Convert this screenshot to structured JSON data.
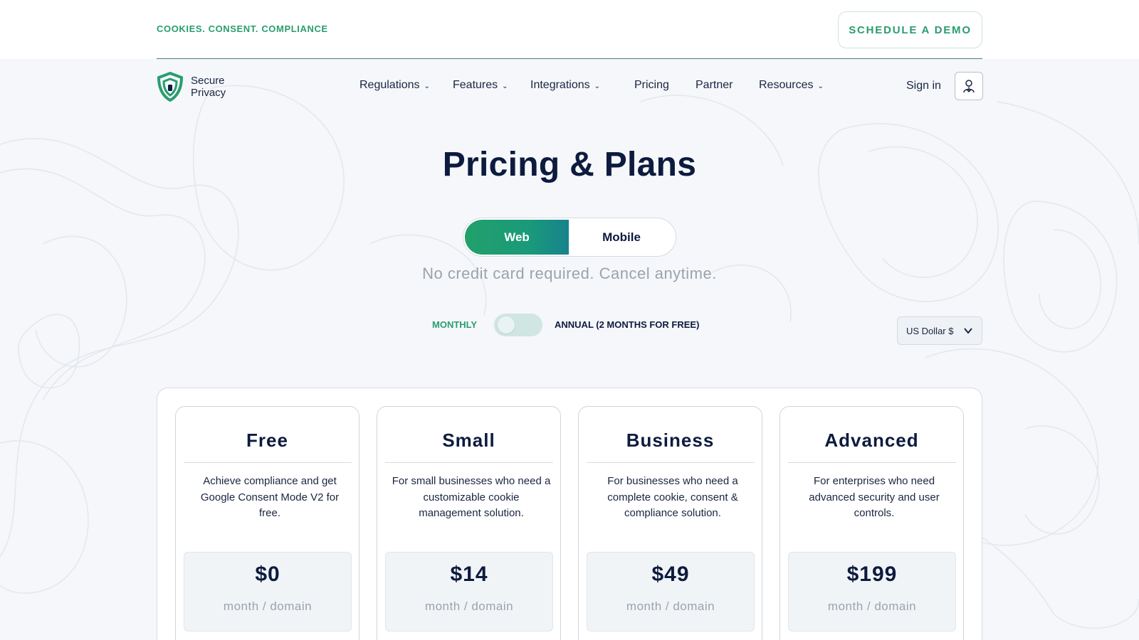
{
  "topbar": {
    "tagline": "COOKIES. CONSENT. COMPLIANCE",
    "demo_label": "SCHEDULE A DEMO"
  },
  "brand": {
    "line1": "Secure",
    "line2": "Privacy",
    "accent": "#2a9d6f"
  },
  "nav": {
    "items": [
      {
        "label": "Regulations",
        "dropdown": true
      },
      {
        "label": "Features",
        "dropdown": true
      },
      {
        "label": "Integrations",
        "dropdown": true
      },
      {
        "label": "Pricing",
        "dropdown": false
      },
      {
        "label": "Partner",
        "dropdown": false
      },
      {
        "label": "Resources",
        "dropdown": true
      }
    ],
    "signin": "Sign in",
    "user_icon": "user-icon"
  },
  "main": {
    "title": "Pricing & Plans",
    "segments": [
      "Web",
      "Mobile"
    ],
    "selected_segment": "Web",
    "subtitle": "No credit card required. Cancel anytime.",
    "billing": {
      "monthly": "MONTHLY",
      "annual": "ANNUAL (2 MONTHS FOR FREE)",
      "toggle_state": "monthly"
    },
    "currency": "US Dollar $"
  },
  "plans": [
    {
      "name": "Free",
      "description": "Achieve compliance and get Google Consent Mode V2 for free.",
      "price": "$0",
      "period": "month / domain"
    },
    {
      "name": "Small",
      "description": "For small businesses who need a customizable cookie management solution.",
      "price": "$14",
      "period": "month / domain"
    },
    {
      "name": "Business",
      "description": "For businesses who need a complete cookie, consent & compliance solution.",
      "price": "$49",
      "period": "month / domain"
    },
    {
      "name": "Advanced",
      "description": "For enterprises who need advanced security and user controls.",
      "price": "$199",
      "period": "month / domain"
    }
  ],
  "colors": {
    "navy": "#0d1b3e",
    "green": "#2a9d6f",
    "gradient_start": "#22a06b",
    "gradient_end": "#17838c"
  }
}
